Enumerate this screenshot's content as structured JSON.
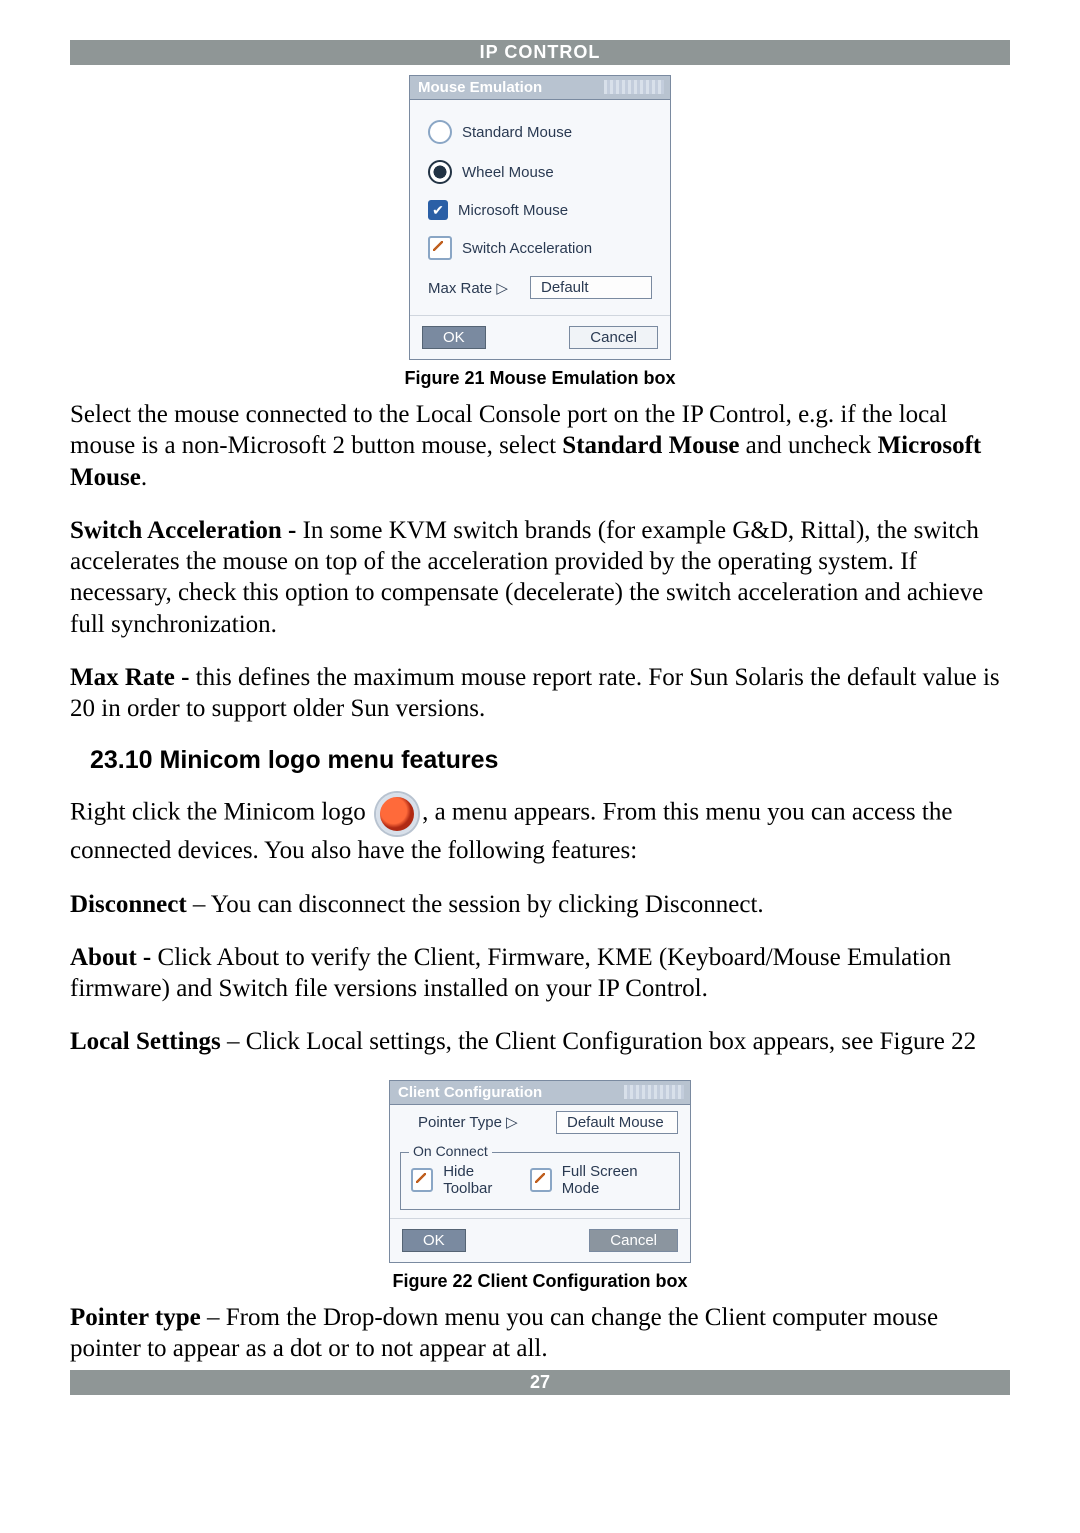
{
  "header": {
    "title": "IP CONTROL"
  },
  "footer": {
    "page": "27"
  },
  "mouseEmulation": {
    "title": "Mouse Emulation",
    "options": {
      "standard": "Standard Mouse",
      "wheel": "Wheel Mouse",
      "microsoft": "Microsoft Mouse",
      "switchAccel": "Switch Acceleration"
    },
    "maxRate": {
      "label": "Max Rate ▷",
      "value": "Default"
    },
    "buttons": {
      "ok": "OK",
      "cancel": "Cancel"
    },
    "caption": "Figure 21 Mouse Emulation box"
  },
  "paragraphs": {
    "p1a": "Select the mouse connected to the Local Console port on the IP Control, e.g. if the local mouse is a non-Microsoft 2 button mouse, select ",
    "p1b": "Standard Mouse",
    "p1c": " and uncheck ",
    "p1d": "Microsoft Mouse",
    "p1e": ".",
    "p2a": "Switch Acceleration - ",
    "p2b": "In some KVM switch brands (for example G&D, Rittal), the switch accelerates the mouse on top of the acceleration provided by the operating system. If necessary, check this option to compensate (decelerate) the switch acceleration and achieve full synchronization.",
    "p3a": "Max Rate - ",
    "p3b": "this defines the maximum mouse report rate. For Sun Solaris the default value is 20 in order to support older Sun versions.",
    "sectionTitle": "23.10 Minicom logo menu features",
    "p4a": "Right click the Minicom logo ",
    "p4b": ", a menu appears. From this menu you can access the connected devices. You also have the following features:",
    "p5a": "Disconnect",
    "p5b": " – You can disconnect the session by clicking Disconnect.",
    "p6a": "About - ",
    "p6b": "Click About to verify the Client, Firmware, KME (Keyboard/Mouse Emulation firmware) and Switch file versions installed on your IP Control.",
    "p7a": "Local Settings",
    "p7b": " – Click Local settings, the Client Configuration box appears, see Figure 22",
    "p8a": "Pointer type",
    "p8b": " – From the Drop-down menu you can change the Client computer mouse pointer to appear as a dot or to not appear at all."
  },
  "clientConfig": {
    "title": "Client Configuration",
    "pointerType": {
      "label": "Pointer Type ▷",
      "value": "Default Mouse"
    },
    "onConnect": {
      "legend": "On Connect",
      "hideToolbar": "Hide Toolbar",
      "fullScreen": "Full Screen Mode"
    },
    "buttons": {
      "ok": "OK",
      "cancel": "Cancel"
    },
    "caption": "Figure 22 Client Configuration box"
  }
}
